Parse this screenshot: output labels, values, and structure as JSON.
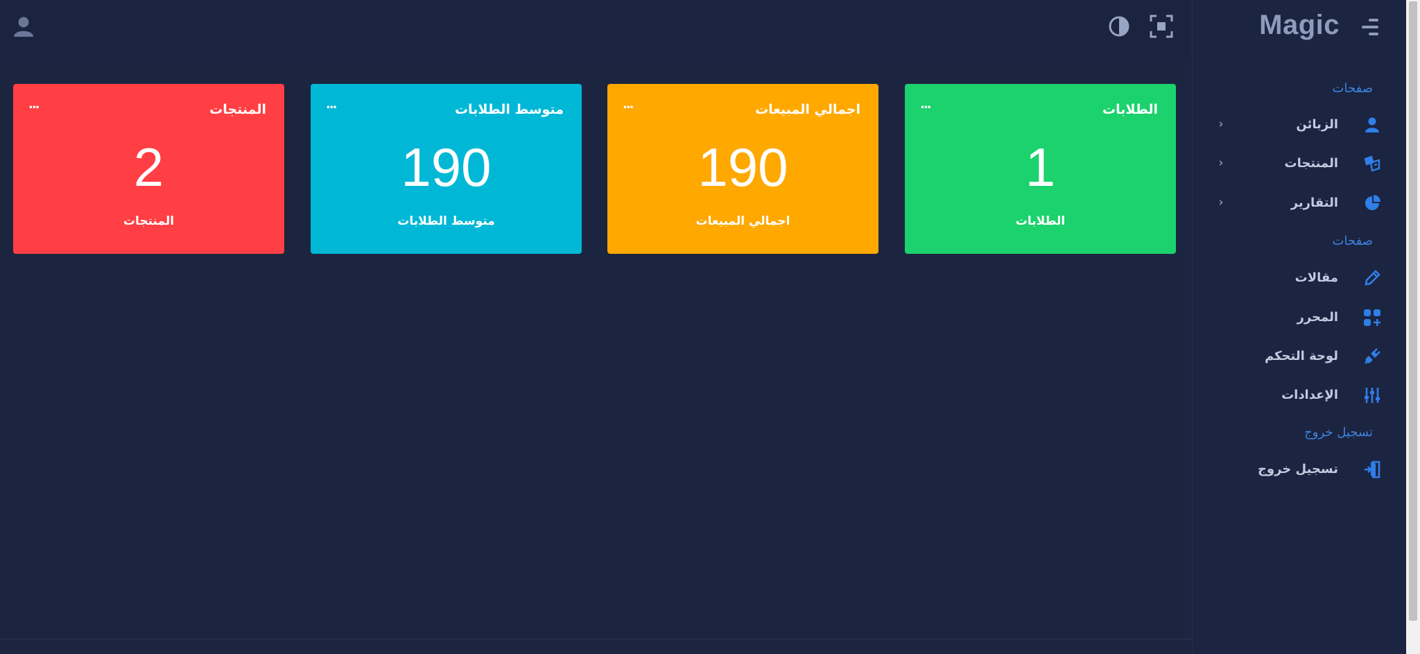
{
  "sidebar": {
    "brand": "Magic",
    "sections": [
      {
        "label": "صفحات"
      },
      {
        "label": "صفحات"
      },
      {
        "label": "تسجيل خروج"
      }
    ],
    "items": [
      {
        "label": "الزبائن",
        "icon": "user-icon",
        "has_submenu": true
      },
      {
        "label": "المنتجات",
        "icon": "products-icon",
        "has_submenu": true
      },
      {
        "label": "التقارير",
        "icon": "pie-chart-icon",
        "has_submenu": true
      },
      {
        "label": "مقالات",
        "icon": "pencil-icon",
        "has_submenu": false
      },
      {
        "label": "المحرر",
        "icon": "apps-icon",
        "has_submenu": false
      },
      {
        "label": "لوحة التحكم",
        "icon": "plug-icon",
        "has_submenu": false
      },
      {
        "label": "الإعدادات",
        "icon": "sliders-icon",
        "has_submenu": false
      },
      {
        "label": "تسجيل خروج",
        "icon": "logout-icon",
        "has_submenu": false
      }
    ],
    "chevron": "›"
  },
  "topbar": {
    "icons": [
      "user-avatar-icon",
      "fullscreen-icon",
      "theme-toggle-icon"
    ]
  },
  "cards": [
    {
      "title": "الطلابات",
      "value": "1",
      "subtitle": "الطلابات",
      "color": "#1bd26c",
      "more": "..."
    },
    {
      "title": "اجمالي المبيعات",
      "value": "190",
      "subtitle": "اجمالي المبيعات",
      "color": "#ffa800",
      "more": "..."
    },
    {
      "title": "متوسط الطلابات",
      "value": "190",
      "subtitle": "متوسط الطلابات",
      "color": "#00b8d6",
      "more": "..."
    },
    {
      "title": "المنتجات",
      "value": "2",
      "subtitle": "المنتجات",
      "color": "#ff3f44",
      "more": "..."
    }
  ],
  "colors": {
    "background": "#1c2540",
    "sidebar_bg": "#1b2440",
    "accent_blue": "#3f84e0",
    "brand_text": "#8e9bbc"
  }
}
